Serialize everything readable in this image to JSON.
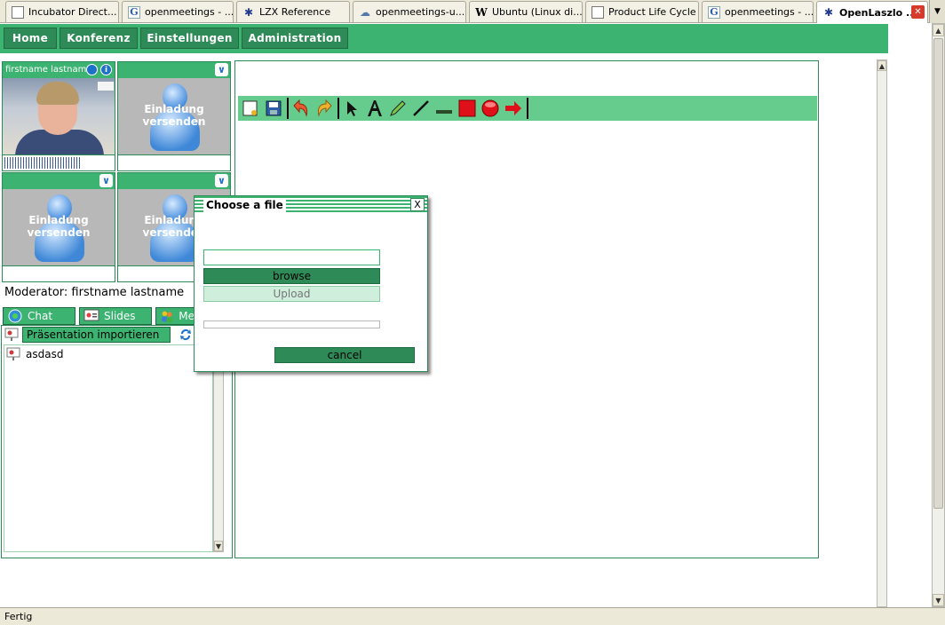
{
  "browser": {
    "tabs": [
      {
        "label": "Incubator Direct...",
        "favicon": "doc-icon"
      },
      {
        "label": "openmeetings - ...",
        "favicon": "google-icon"
      },
      {
        "label": "LZX Reference",
        "favicon": "laszlo-icon"
      },
      {
        "label": "openmeetings-u...",
        "favicon": "discussion-icon"
      },
      {
        "label": "Ubuntu (Linux di...",
        "favicon": "wikipedia-icon"
      },
      {
        "label": "Product Life Cycle",
        "favicon": "doc-icon"
      },
      {
        "label": "openmeetings - ...",
        "favicon": "google-icon"
      },
      {
        "label": "OpenLaszlo ...",
        "favicon": "laszlo-icon",
        "active": true
      }
    ],
    "status": "Fertig"
  },
  "nav": {
    "items": [
      "Home",
      "Konferenz",
      "Einstellungen",
      "Administration"
    ]
  },
  "videos": {
    "self_name": "firstname lastname",
    "invite_text_1": "Einladung",
    "invite_text_2": "versenden"
  },
  "moderator": {
    "text": "Moderator: firstname lastname"
  },
  "sidebar": {
    "tabs": {
      "chat": "Chat",
      "slides": "Slides",
      "members": "Me"
    },
    "import_button": "Präsentation importieren",
    "files": [
      "asdasd"
    ]
  },
  "whiteboard": {
    "tools": [
      "new-document-icon",
      "save-icon",
      "undo-icon",
      "redo-icon",
      "pointer-icon",
      "text-icon",
      "pencil-icon",
      "line-icon",
      "underline-icon",
      "rectangle-icon",
      "ellipse-icon",
      "arrow-icon"
    ]
  },
  "dialog": {
    "title": "Choose a file",
    "file_value": "",
    "browse_label": "browse",
    "upload_label": "Upload",
    "cancel_label": "cancel",
    "close_label": "X",
    "progress": 0
  },
  "colors": {
    "primary_green": "#3cb371",
    "dark_green": "#2e8b57",
    "light_green": "#66cc8e"
  }
}
